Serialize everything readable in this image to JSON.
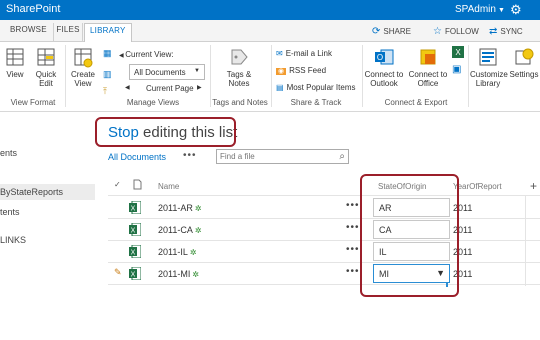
{
  "suite": {
    "title": "SharePoint",
    "user": "SPAdmin"
  },
  "tabs": {
    "browse": "BROWSE",
    "files": "FILES",
    "library": "LIBRARY"
  },
  "tab_actions": {
    "share": "SHARE",
    "follow": "FOLLOW",
    "sync": "SYNC"
  },
  "ribbon": {
    "view_format": {
      "view": "View",
      "quick_edit_1": "Quick",
      "quick_edit_2": "Edit",
      "label": "View Format"
    },
    "manage_views": {
      "create_view_1": "Create",
      "create_view_2": "View",
      "current_view_label": "Current View:",
      "current_view_value": "All Documents",
      "current_page": "Current Page",
      "label": "Manage Views"
    },
    "tags_notes": {
      "tags": "Tags &",
      "notes": "Notes",
      "label": "Tags and Notes"
    },
    "share_track": {
      "email_link": "E-mail a Link",
      "rss_feed": "RSS Feed",
      "most_popular": "Most Popular Items",
      "label": "Share & Track"
    },
    "connect_export": {
      "outlook_1": "Connect to",
      "outlook_2": "Outlook",
      "office_1": "Connect to",
      "office_2": "Office",
      "label": "Connect & Export"
    },
    "customize": {
      "customize_1": "Customize",
      "customize_2": "Library",
      "settings": "Settings"
    }
  },
  "left_nav": {
    "item1": "ents",
    "item2": "ByStateReports",
    "item3": "tents",
    "item4": "LINKS"
  },
  "main": {
    "title_stop": "Stop",
    "title_rest": " editing this list",
    "view_all": "All Documents",
    "view_more": "•••",
    "search_placeholder": "Find a file",
    "headers": {
      "name": "Name",
      "state": "StateOfOrigin",
      "year": "YearOfReport",
      "add": "+"
    },
    "rows": [
      {
        "name": "2011-AR",
        "state": "AR",
        "year": "2011"
      },
      {
        "name": "2011-CA",
        "state": "CA",
        "year": "2011"
      },
      {
        "name": "2011-IL",
        "state": "IL",
        "year": "2011"
      },
      {
        "name": "2011-MI",
        "state": "MI",
        "year": "2011"
      }
    ],
    "row_more": "•••",
    "new_marker": "✲"
  },
  "colors": {
    "accent": "#0072c6",
    "callout": "#9b1f2a",
    "excel": "#207245"
  }
}
